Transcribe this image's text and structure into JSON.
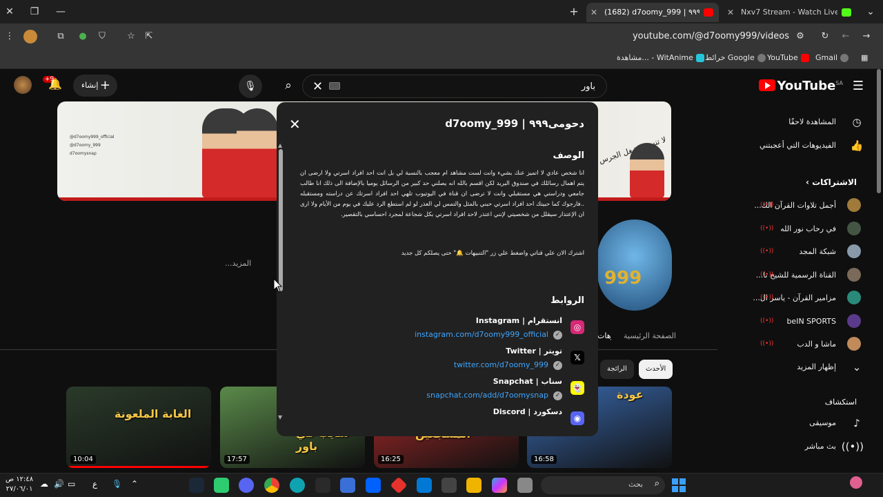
{
  "browser": {
    "tabs": [
      {
        "title": "(1682) d7oomy_999 | دحومى٩٩٩",
        "active": true
      },
      {
        "title": "Nxv7 Stream - Watch Live on Ki",
        "active": false
      }
    ],
    "url": "youtube.com/@d7oomy999/videos",
    "bookmarks": [
      "Gmail",
      "YouTube",
      "خرائط Google",
      "مشاهدة... - WitAnime"
    ]
  },
  "header": {
    "search_value": "باور",
    "create_label": "إنشاء",
    "notif_count": "+9"
  },
  "sidebar": {
    "logo": "YouTube",
    "region": "SA",
    "items": [
      {
        "label": "المشاهدة لاحقًا",
        "icon": "clock-icon"
      },
      {
        "label": "الفيديوهات التي أعجبتني",
        "icon": "thumbs-up-icon"
      }
    ],
    "subs_heading": "الاشتراكات",
    "subs": [
      {
        "label": "أجمل تلاوات القرآن الك...",
        "color": "#a07a3a"
      },
      {
        "label": "في رحاب نور الله",
        "color": "#445544"
      },
      {
        "label": "شبكة المجد",
        "color": "#8899aa"
      },
      {
        "label": "القناة الرسمية للشيخ نا...",
        "color": "#7a6a5a"
      },
      {
        "label": "مزامير القرآن - ياسر ال...",
        "color": "#2a8a7a"
      },
      {
        "label": "beIN SPORTS",
        "color": "#5a3a8a"
      },
      {
        "label": "ماشا و الدب",
        "color": "#c08a5a"
      }
    ],
    "show_more": "إظهار المزيد",
    "explore_heading": "استكشاف",
    "explore": [
      {
        "label": "موسيقى",
        "icon": "music-icon"
      },
      {
        "label": "بث مباشر",
        "icon": "live-icon"
      }
    ]
  },
  "channel": {
    "banner_handles": [
      "@d7oomy999_official",
      "@d7oomy_999",
      "d7oomysnap"
    ],
    "banner_text_left": "لا تنسى تشغل الج",
    "banner_text_right": "لا تنسى تشغل الجرس",
    "more": "...المزيد",
    "tabs": [
      "الصفحة الرئيسية",
      "الفيديوهات"
    ],
    "chips": [
      "الأحدث",
      "الرائجة"
    ]
  },
  "videos": [
    {
      "duration": "16:58",
      "title": "عودة",
      "bg": "#3a6ab0"
    },
    {
      "duration": "16:25",
      "title": "رئيس رابطة المشجعين",
      "bg": "#b02a2a"
    },
    {
      "duration": "17:57",
      "title": "شايب في باور",
      "bg": "#5a8a4a"
    },
    {
      "duration": "10:04",
      "title": "الغابة الملعونة",
      "bg": "#2a3a2a"
    }
  ],
  "dialog": {
    "title": "دحومى٩٩٩ | d7oomy_999",
    "description_heading": "الوصف",
    "description": "انا شخص عادي لا اتميز عنك بشيء وانت لست مشاهد ام معجب بالنسبة لي بل انت احد افراد اسرتي ولا ارضى ان يتم اهمال رسائلك في صندوق البريد لكن اقسم بالله انه يصلني حد كبير من الرسائل يوميا بالإضافة الى ذلك انا طالب جامعي ودراستي هي مستقبلي وانت لا ترضى ان قناة في اليوتيوب تلهي احد افراد اسرتك عن دراسته ومستقبله ..فارجوك كما حبيتك احد افراد اسرتي حبني بالمثل والتمس لي العذر لو لم استطع الرد عليك في يوم من الأيام ولا ارى ان الإعتذار سيقلل من شخصيتي لإنني اعتذر لاحد افراد اسرتي بكل شجاعة لمجرد احساسي بالتقصير.",
    "cta": "اشترك الان علي قناتي واضغط علي زر \"التنبيهات 🔔\" حتى يصلكم كل جديد",
    "links_heading": "الروابط",
    "links": [
      {
        "name": "انستقرام | Instagram",
        "url": "instagram.com/d7oomy999_official",
        "icon": "instagram-icon",
        "bg": "#d62976",
        "glyph": "◎"
      },
      {
        "name": "تويتر | Twitter",
        "url": "twitter.com/d7oomy_999",
        "icon": "x-icon",
        "bg": "#000000",
        "glyph": "𝕏"
      },
      {
        "name": "سناب | Snapchat",
        "url": "snapchat.com/add/d7oomysnap",
        "icon": "snapchat-icon",
        "bg": "#fffc00",
        "glyph": "👻"
      },
      {
        "name": "دسكورد | Discord",
        "url": "",
        "icon": "discord-icon",
        "bg": "#5865f2",
        "glyph": "◉"
      }
    ]
  },
  "taskbar": {
    "search_label": "بحث",
    "time": "١٢:٤٨ ص",
    "date": "٢٧/٠٦/٠١",
    "lang": "ع"
  }
}
